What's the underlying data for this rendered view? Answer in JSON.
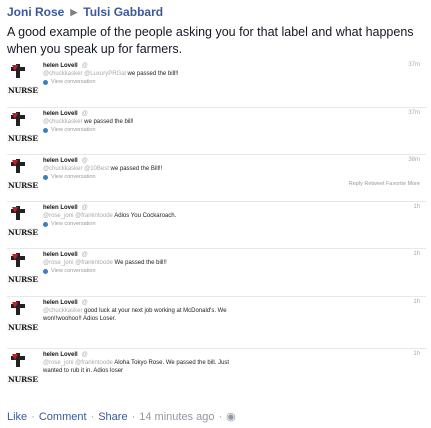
{
  "header": {
    "author": "Joni Rose",
    "target": "Tulsi Gabbard"
  },
  "post": {
    "text": "A good example of the people asking you for that label and what happens when you speak up for farmers."
  },
  "tweets": [
    {
      "name": "helen Lovell",
      "handle": "@",
      "time": "37m",
      "text_mention": "@chuckkasker @LuxuryPRGal",
      "text_rest": " we passed the bill!!",
      "view": "View conversation"
    },
    {
      "name": "helen Lovell",
      "handle": "@",
      "time": "37m",
      "text_mention": "@chuckkasker",
      "text_rest": " we passed the bill!",
      "view": "View conversation"
    },
    {
      "name": "helen Lovell",
      "handle": "@",
      "time": "38m",
      "text_mention": "@chuckkasker @10Best",
      "text_rest": " we passed the Bill!!",
      "view": "View conversation",
      "actions": "Reply   Retweet   Favorite   More"
    },
    {
      "name": "helen Lovell",
      "handle": "@",
      "time": "1h",
      "text_mention": "@rose_joni @frankntoode",
      "text_rest": " Adios You Cockaroach.",
      "view": "View conversation"
    },
    {
      "name": "helen Lovell",
      "handle": "@",
      "time": "1h",
      "text_mention": "@rose_joni @frankntoode",
      "text_rest": " We passed the bill!!",
      "view": "View conversation"
    },
    {
      "name": "helen Lovell",
      "handle": "@",
      "time": "1h",
      "text_mention": "@chuckkasker",
      "text_rest": " good luck at your next job working at McDonald's. We",
      "text_line2": "won!!woohoo!! Adios Loser.",
      "view": ""
    },
    {
      "name": "helen Lovell",
      "handle": "@",
      "time": "1h",
      "text_mention": "@rose_joni @frankntoode",
      "text_rest": " Aloha Tokyo Rose. We passed the bill. Just",
      "text_line2": "wanted to rub it in. Adios loser",
      "view": ""
    }
  ],
  "avatar_label": "NURSE",
  "footer": {
    "like": "Like",
    "comment": "Comment",
    "share": "Share",
    "time": "14 minutes ago"
  },
  "colors": {
    "link": "#3b5998",
    "meta": "#9197a3",
    "badge": "#c4202b"
  }
}
